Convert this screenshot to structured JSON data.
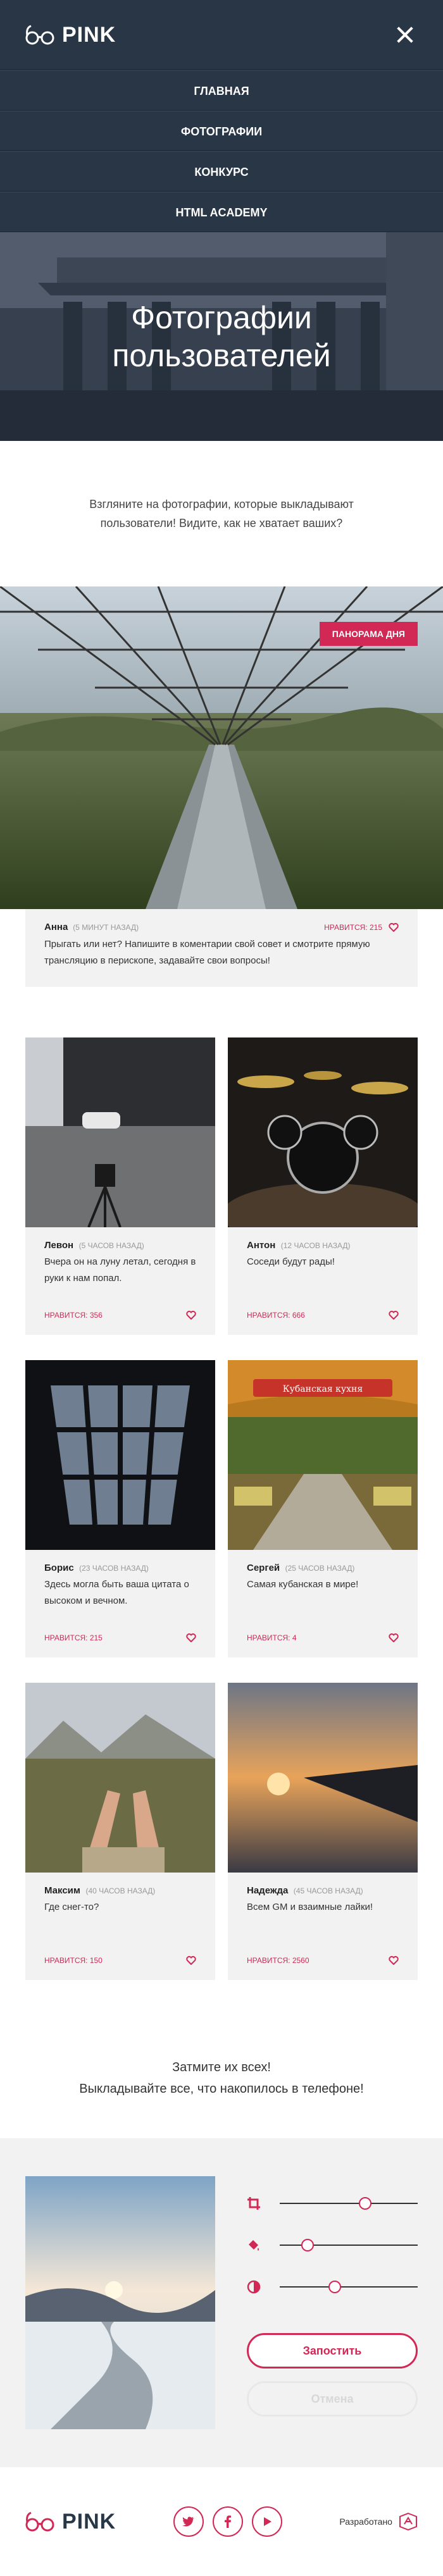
{
  "header": {
    "logo_text": "PINK",
    "nav": [
      "Главная",
      "Фотографии",
      "Конкурс",
      "HTML Academy"
    ]
  },
  "hero": {
    "title_line1": "Фотографии",
    "title_line2": "пользователей"
  },
  "intro": {
    "text": "Взгляните на фотографии, которые выкладывают пользователи! Видите, как не хватает ваших?"
  },
  "panorama": {
    "badge": "Панорама дня",
    "author": "Анна",
    "time": "(5 минут назад)",
    "likes": "Нравится: 215",
    "text": "Прыгать или нет? Напишите в коментарии свой совет и смотрите прямую трансляцию в перископе, задавайте свои вопросы!"
  },
  "photos": [
    {
      "author": "Левон",
      "time": "(5 часов назад)",
      "text": "Вчера он на луну летал, сегодня в руки к нам попал.",
      "likes": "Нравится: 356"
    },
    {
      "author": "Антон",
      "time": "(12 часов назад)",
      "text": "Соседи будут рады!",
      "likes": "Нравится: 666"
    },
    {
      "author": "Борис",
      "time": "(23 часов назад)",
      "text": "Здесь могла быть ваша цитата о высоком и вечном.",
      "likes": "Нравится: 215"
    },
    {
      "author": "Сергей",
      "time": "(25 часов назад)",
      "text": "Самая кубанская в мире!",
      "likes": "Нравится: 4"
    },
    {
      "author": "Максим",
      "time": "(40 часов назад)",
      "text": "Где снег-то?",
      "likes": "Нравится: 150"
    },
    {
      "author": "Надежда",
      "time": "(45 часов назад)",
      "text": "Всем GM и взаимные лайки!",
      "likes": "Нравится: 2560"
    }
  ],
  "photo_sign": "Кубанская кухня",
  "outro": {
    "line1": "Затмите их всех!",
    "line2": "Выкладывайте все, что накопилось в телефоне!"
  },
  "editor": {
    "sliders": [
      {
        "icon": "crop-icon",
        "value": 0.62
      },
      {
        "icon": "fill-icon",
        "value": 0.2
      },
      {
        "icon": "contrast-icon",
        "value": 0.4
      }
    ],
    "submit_label": "Запостить",
    "cancel_label": "Отмена"
  },
  "footer": {
    "logo_text": "PINK",
    "socials": [
      "twitter-icon",
      "facebook-icon",
      "youtube-icon"
    ],
    "developed_label": "Разработано"
  },
  "colors": {
    "accent": "#d22856",
    "header_bg": "#283645",
    "card_bg": "#f2f2f2"
  }
}
